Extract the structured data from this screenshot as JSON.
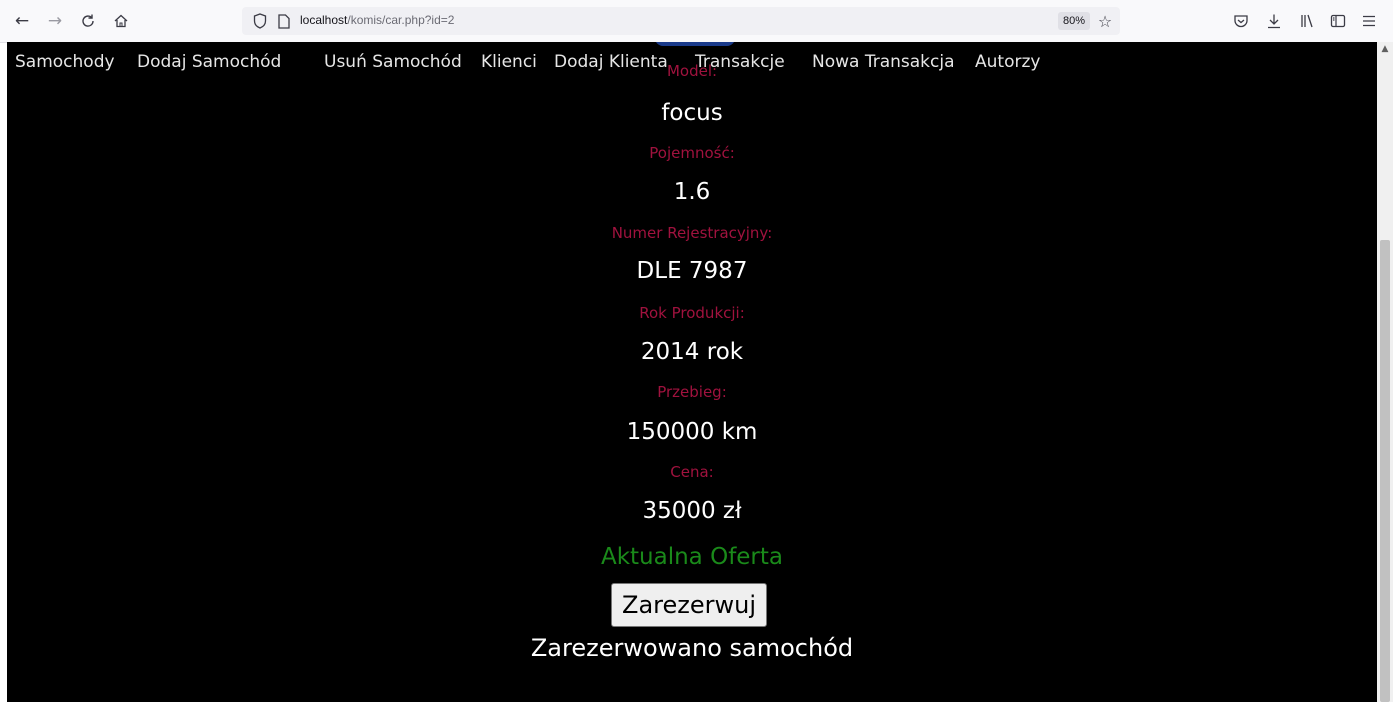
{
  "browser": {
    "url_host": "localhost",
    "url_path": "/komis/car.php?id=2",
    "zoom": "80%",
    "icons": [
      "back-icon",
      "forward-icon",
      "reload-icon",
      "home-icon",
      "shield-icon",
      "page-icon",
      "star-icon",
      "pocket-icon",
      "download-icon",
      "library-icon",
      "sidebar-icon",
      "menu-icon"
    ]
  },
  "nav": {
    "items": [
      "Samochody",
      "Dodaj Samochód",
      "Usuń Samochód",
      "Klienci",
      "Dodaj Klienta",
      "Transakcje",
      "Nowa Transakcja",
      "Autorzy"
    ]
  },
  "car": {
    "model_label": "Model:",
    "model": "focus",
    "engine_label": "Pojemność:",
    "engine": "1.6",
    "plate_label": "Numer Rejestracyjny:",
    "plate": "DLE 7987",
    "year_label": "Rok Produkcji:",
    "year": "2014 rok",
    "mileage_label": "Przebieg:",
    "mileage": "150000 km",
    "price_label": "Cena:",
    "price": "35000 zł"
  },
  "status": "Aktualna Oferta",
  "reserve_button": "Zarezerwuj",
  "message": "Zarezerwowano samochód",
  "colors": {
    "label": "#a0123e",
    "status": "#1a8a1a",
    "background": "#000000"
  }
}
